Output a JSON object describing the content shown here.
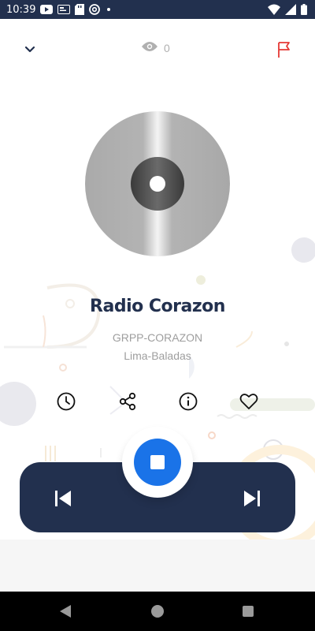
{
  "status_bar": {
    "time": "10:39",
    "icons": [
      "youtube-icon",
      "id-card-icon",
      "sd-card-icon",
      "at-sign-icon",
      "notification-dot"
    ],
    "right_icons": [
      "wifi-icon",
      "signal-icon",
      "battery-icon"
    ]
  },
  "top_bar": {
    "viewer_count": "0",
    "icons": [
      "chevron-down-icon",
      "eye-icon",
      "flag-icon"
    ],
    "flag_color": "#e53935"
  },
  "station": {
    "name": "Radio Corazon",
    "code": "GRPP-CORAZON",
    "genre": "Lima-Baladas"
  },
  "actions": [
    "clock-icon",
    "share-icon",
    "info-icon",
    "heart-icon"
  ],
  "player": {
    "state_icon": "stop-icon",
    "prev_icon": "skip-previous-icon",
    "next_icon": "skip-next-icon",
    "bar_color": "#22304e",
    "button_color": "#1a73e8"
  },
  "nav_bar": {
    "icons": [
      "back-icon",
      "home-icon",
      "recents-icon"
    ]
  }
}
